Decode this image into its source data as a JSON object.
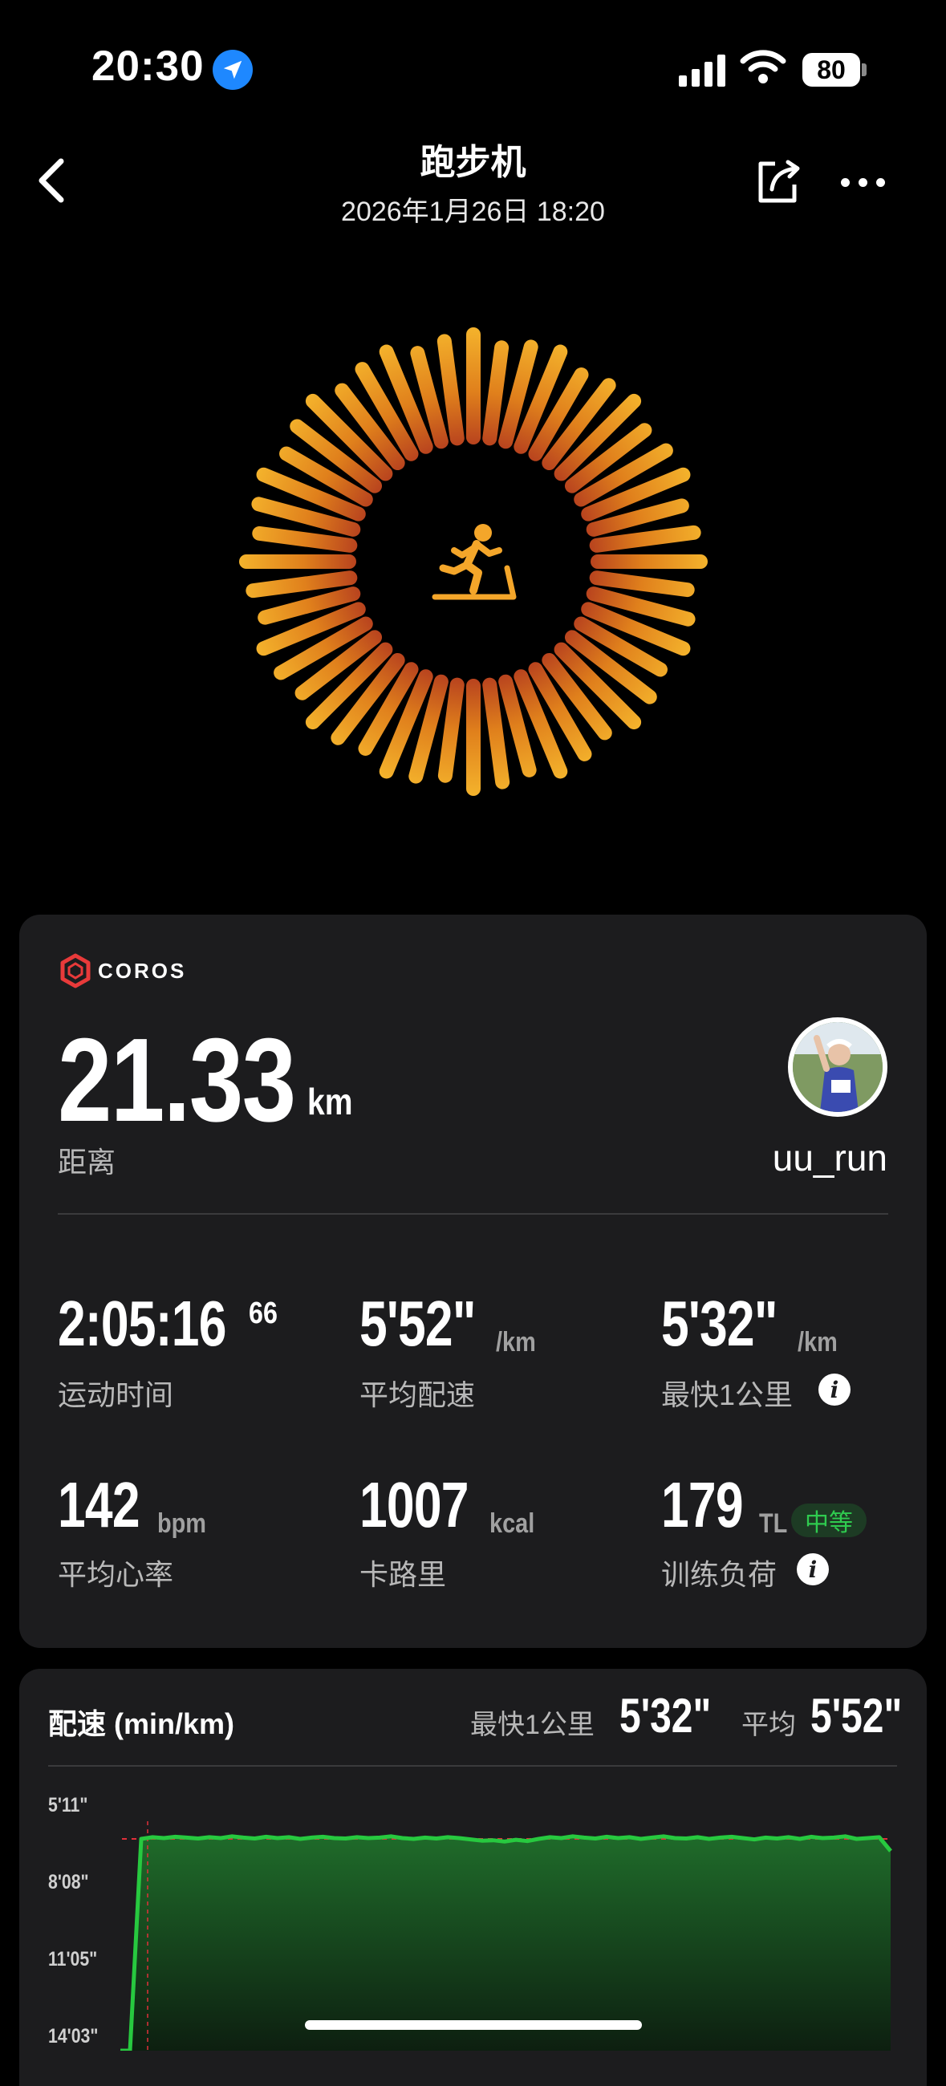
{
  "status_bar": {
    "time": "20:30",
    "battery": "80"
  },
  "nav": {
    "title": "跑步机",
    "subtitle": "2026年1月26日 18:20"
  },
  "brand": {
    "name": "COROS"
  },
  "summary": {
    "distance_value": "21.33",
    "distance_unit": "km",
    "distance_label": "距离",
    "username": "uu_run"
  },
  "stats": [
    {
      "value": "2:05:16",
      "sup": "66",
      "unit": "",
      "label": "运动时间",
      "info": false,
      "badge": ""
    },
    {
      "value": "5'52\"",
      "sup": "",
      "unit": "/km",
      "label": "平均配速",
      "info": false,
      "badge": ""
    },
    {
      "value": "5'32\"",
      "sup": "",
      "unit": "/km",
      "label": "最快1公里",
      "info": true,
      "badge": ""
    },
    {
      "value": "142",
      "sup": "",
      "unit": "bpm",
      "label": "平均心率",
      "info": false,
      "badge": ""
    },
    {
      "value": "1007",
      "sup": "",
      "unit": "kcal",
      "label": "卡路里",
      "info": false,
      "badge": ""
    },
    {
      "value": "179",
      "sup": "",
      "unit": "TL",
      "label": "训练负荷",
      "info": true,
      "badge": "中等"
    }
  ],
  "pace_section": {
    "title": "配速 (min/km)",
    "fastest_label": "最快1公里",
    "fastest_value": "5'32\"",
    "average_label": "平均",
    "average_value": "5'52\"",
    "y_ticks": [
      "5'11\"",
      "8'08\"",
      "11'05\"",
      "14'03\""
    ]
  },
  "chart_data": {
    "type": "area",
    "title": "配速 (min/km)",
    "ylabel": "",
    "xlabel": "",
    "y_ticks": [
      "5'11\"",
      "8'08\"",
      "11'05\"",
      "14'03\""
    ],
    "y_range_seconds": [
      311,
      843
    ],
    "average_line_seconds": 352,
    "series": [
      {
        "values_seconds": [
          843,
          843,
          352,
          348,
          350,
          347,
          349,
          351,
          348,
          350,
          346,
          349,
          351,
          347,
          350,
          348,
          352,
          349,
          347,
          350,
          351,
          348,
          350,
          349,
          346,
          350,
          352,
          349,
          351,
          348,
          350,
          353,
          356,
          355,
          358,
          354,
          357,
          352,
          348,
          350,
          346,
          349,
          351,
          347,
          350,
          348,
          352,
          349,
          346,
          350,
          351,
          348,
          352,
          349,
          347,
          350,
          353,
          349,
          351,
          348,
          352,
          347,
          350,
          349,
          346,
          352,
          350,
          348,
          380
        ]
      }
    ],
    "colors": {
      "line": "#27c93f",
      "fill_top": "#1f6b2a",
      "fill_bottom": "#0d1f10",
      "average": "#e0303a"
    }
  }
}
